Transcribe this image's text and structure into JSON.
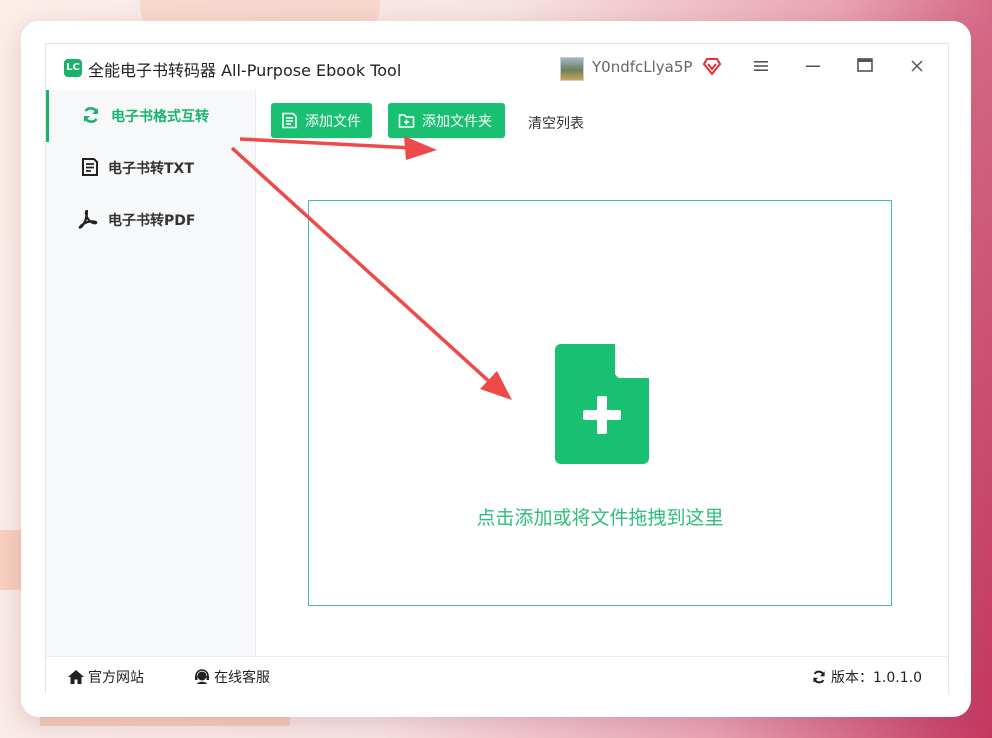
{
  "app": {
    "title": "全能电子书转码器 All-Purpose Ebook Tool",
    "username": "Y0ndfcLlya5P",
    "accent": "#19b36b"
  },
  "sidebar": {
    "items": [
      {
        "label": "电子书格式互转",
        "icon": "refresh-icon",
        "active": true
      },
      {
        "label": "电子书转TXT",
        "icon": "document-icon",
        "active": false
      },
      {
        "label": "电子书转PDF",
        "icon": "pdf-icon",
        "active": false
      }
    ]
  },
  "toolbar": {
    "add_file": "添加文件",
    "add_folder": "添加文件夹",
    "clear_list": "清空列表"
  },
  "dropzone": {
    "hint": "点击添加或将文件拖拽到这里",
    "icon": "file-add-icon"
  },
  "footer": {
    "website": "官方网站",
    "support": "在线客服",
    "version": "版本：1.0.1.0"
  }
}
